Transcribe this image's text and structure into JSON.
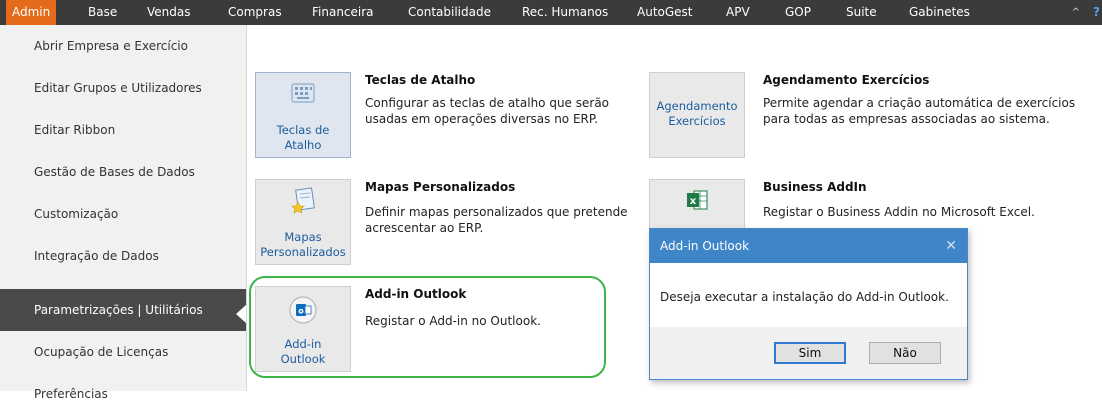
{
  "menu": {
    "items": [
      "Admin",
      "Base",
      "Vendas",
      "Compras",
      "Financeira",
      "Contabilidade",
      "Rec. Humanos",
      "AutoGest",
      "APV",
      "GOP",
      "Suite",
      "Gabinetes"
    ],
    "active_index": 0,
    "collapse_glyph": "^",
    "help_glyph": "?"
  },
  "sidebar": {
    "items": [
      "Abrir Empresa e Exercício",
      "Editar Grupos e Utilizadores",
      "Editar Ribbon",
      "Gestão de Bases de Dados",
      "Customização",
      "Integração de Dados",
      "Parametrizações | Utilitários",
      "Ocupação de Licenças",
      "Preferências"
    ],
    "active_index": 6
  },
  "tiles": [
    {
      "button_label": "Teclas de\nAtalho",
      "title": "Teclas de Atalho",
      "description": "Configurar as teclas de atalho que serão usadas em operações diversas no ERP.",
      "icon": "keyboard-icon"
    },
    {
      "button_label": "Agendamento\nExercícios",
      "title": "Agendamento Exercícios",
      "description": "Permite agendar a criação automática de exercícios para todas as empresas associadas ao sistema.",
      "icon": ""
    },
    {
      "button_label": "Mapas\nPersonalizados",
      "title": "Mapas Personalizados",
      "description": "Definir mapas personalizados que pretende acrescentar ao ERP.",
      "icon": "custom-map-icon"
    },
    {
      "button_label": "",
      "title": "Business AddIn",
      "description": "Registar o Business Addin no Microsoft Excel.",
      "icon": "excel-icon"
    },
    {
      "button_label": "Add-in\nOutlook",
      "title": "Add-in Outlook",
      "description": "Registar o Add-in no Outlook.",
      "icon": "outlook-icon"
    }
  ],
  "dialog": {
    "title": "Add-in Outlook",
    "message": "Deseja executar a instalação do Add-in Outlook.",
    "yes_label": "Sim",
    "no_label": "Não",
    "close_glyph": "✕"
  },
  "colors": {
    "menu_bg": "#3b3b3b",
    "menu_active": "#e46b1a",
    "sidebar_active": "#4a4a4a",
    "dialog_title": "#3f86c9",
    "highlight": "#3db34a"
  }
}
